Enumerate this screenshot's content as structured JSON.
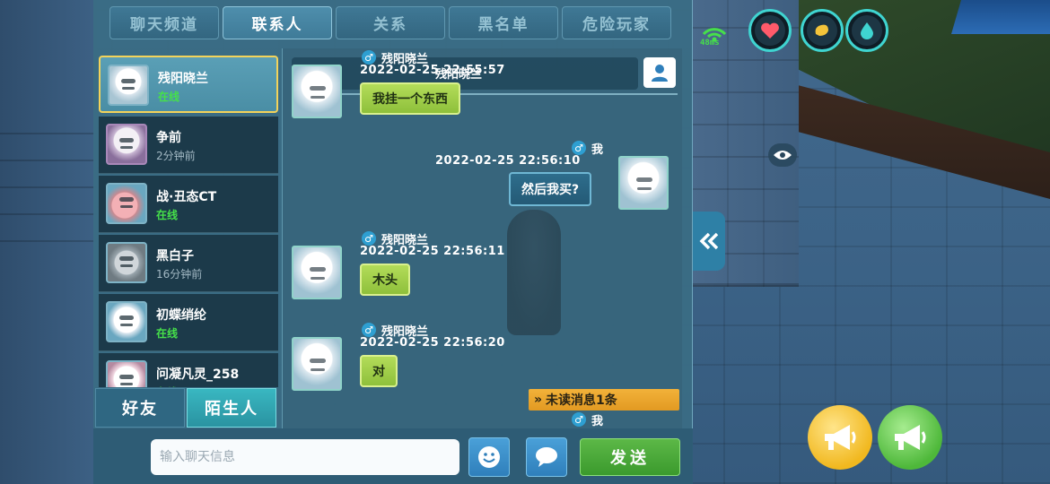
{
  "tabs": [
    "聊天频道",
    "联系人",
    "关系",
    "黑名单",
    "危险玩家"
  ],
  "active_tab": 1,
  "contacts": [
    {
      "name": "残阳晓兰",
      "status": "在线",
      "online": true
    },
    {
      "name": "争前",
      "status": "2分钟前",
      "online": false
    },
    {
      "name": "战·丑态CT",
      "status": "在线",
      "online": true
    },
    {
      "name": "黑白子",
      "status": "16分钟前",
      "online": false
    },
    {
      "name": "初蝶绡纶",
      "status": "在线",
      "online": true
    },
    {
      "name": "问凝凡灵_258",
      "status": "在线",
      "online": true
    }
  ],
  "list_buttons": {
    "friends": "好友",
    "strangers": "陌生人"
  },
  "top_strip_name": "残阳晓兰",
  "messages": [
    {
      "sender": "残阳晓兰",
      "time": "2022-02-25  22:55:57",
      "text": "我挂一个东西",
      "self": false
    },
    {
      "sender": "我",
      "time": "2022-02-25  22:56:10",
      "text": "然后我买?",
      "self": true
    },
    {
      "sender": "残阳晓兰",
      "time": "2022-02-25  22:56:11",
      "text": "木头",
      "self": false
    },
    {
      "sender": "残阳晓兰",
      "time": "2022-02-25  22:56:20",
      "text": "对",
      "self": false
    },
    {
      "sender": "我",
      "time": "",
      "text": "",
      "self": true
    }
  ],
  "unread": "未读消息1条",
  "input": {
    "placeholder": "输入聊天信息",
    "value": ""
  },
  "send_label": "发送",
  "hud": {
    "ping": "48ms"
  },
  "colors": {
    "accent_green": "#8ec03b",
    "online": "#46e04a",
    "unread": "#e29a22",
    "selected_border": "#f3d35a"
  }
}
